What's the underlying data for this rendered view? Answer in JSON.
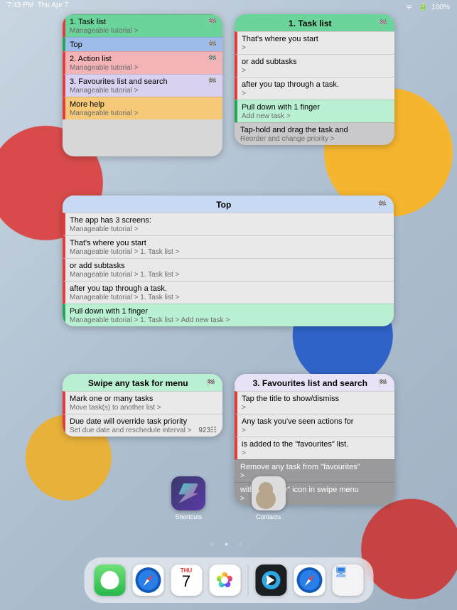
{
  "status": {
    "time": "7:43 PM",
    "date": "Thu Apr 7",
    "wifi": "▲",
    "battery_pct": "100%"
  },
  "calendar": {
    "dow": "THU",
    "day": "7"
  },
  "pagedots": "○ ● ○",
  "apps": [
    {
      "name": "Shortcuts"
    },
    {
      "name": "Contacts"
    }
  ],
  "widgets": {
    "w1": {
      "rows": [
        {
          "bg": "bg-green",
          "bar": "bar-red",
          "flag": true,
          "t": "1. Task list",
          "s": "Manageable tutorial >"
        },
        {
          "bg": "bg-blue",
          "bar": "bar-green",
          "flag": true,
          "t": "Top",
          "s": ""
        },
        {
          "bg": "bg-pink",
          "bar": "bar-red",
          "flag": true,
          "t": "2. Action list",
          "s": "Manageable tutorial >"
        },
        {
          "bg": "bg-lav",
          "bar": "bar-red",
          "flag": true,
          "t": "3. Favourites list and search",
          "s": "Manageable tutorial >"
        },
        {
          "bg": "bg-orange",
          "bar": "bar-red",
          "flag": false,
          "t": "More help",
          "s": "Manageable tutorial >"
        }
      ]
    },
    "w2": {
      "title": "1. Task list",
      "rows": [
        {
          "bg": "bg-white",
          "bar": "bar-red",
          "t": "That's where you start",
          "s": ">"
        },
        {
          "bg": "bg-white",
          "bar": "bar-red",
          "t": "or add subtasks",
          "s": ">"
        },
        {
          "bg": "bg-white",
          "bar": "bar-red",
          "t": "after you tap through a task.",
          "s": ">"
        },
        {
          "bg": "bg-green2",
          "bar": "bar-green",
          "t": "Pull down with 1 finger",
          "s": "Add new task >"
        },
        {
          "bg": "bg-grey",
          "bar": "",
          "t": "Tap-hold and drag the task and",
          "s": "Reorder and change priority >"
        }
      ]
    },
    "w3": {
      "title": "Top",
      "rows": [
        {
          "bg": "bg-white",
          "bar": "bar-red",
          "t": "The app has 3 screens:",
          "s": "Manageable tutorial >"
        },
        {
          "bg": "bg-white",
          "bar": "bar-red",
          "t": "That's where you start",
          "s": "Manageable tutorial > 1. Task list >"
        },
        {
          "bg": "bg-white",
          "bar": "bar-red",
          "t": "or add subtasks",
          "s": "Manageable tutorial > 1. Task list >"
        },
        {
          "bg": "bg-white",
          "bar": "bar-red",
          "t": "after you tap through a task.",
          "s": "Manageable tutorial > 1. Task list >"
        },
        {
          "bg": "bg-green2",
          "bar": "bar-green",
          "t": "Pull down with 1 finger",
          "s": "Manageable tutorial > 1. Task list > Add new task >"
        }
      ]
    },
    "w4": {
      "title": "Swipe any task for menu",
      "rows": [
        {
          "bg": "bg-white",
          "bar": "bar-red",
          "t": "Mark one or many tasks",
          "s": "Move task(s) to another list >"
        },
        {
          "bg": "bg-white",
          "bar": "bar-red",
          "t": "Due date will override task priority",
          "s": "Set due date and reschedule interval >",
          "note": "923☷"
        }
      ]
    },
    "w5": {
      "title": "3. Favourites list and search",
      "rows": [
        {
          "bg": "bg-white",
          "bar": "bar-red",
          "t": "Tap the title to show/dismiss",
          "s": ">"
        },
        {
          "bg": "bg-white",
          "bar": "bar-red",
          "t": "Any task you've seen actions for",
          "s": ">"
        },
        {
          "bg": "bg-white",
          "bar": "bar-red",
          "t": "is added to the \"favourites\" list.",
          "s": ">"
        },
        {
          "bg": "bg-dgrey",
          "bar": "",
          "t": "Remove any task from \"favourites\"",
          "s": ">"
        },
        {
          "bg": "bg-dgrey",
          "bar": "",
          "t": "with \"no entry\" icon in swipe menu",
          "s": ">"
        }
      ]
    }
  }
}
